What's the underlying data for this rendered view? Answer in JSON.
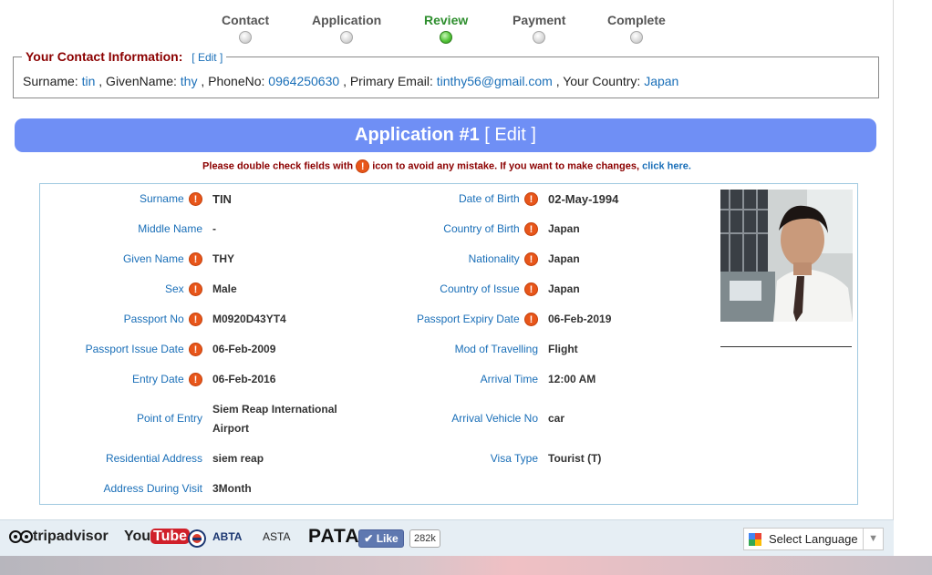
{
  "steps": [
    {
      "label": "Contact",
      "active": false
    },
    {
      "label": "Application",
      "active": false
    },
    {
      "label": "Review",
      "active": true
    },
    {
      "label": "Payment",
      "active": false
    },
    {
      "label": "Complete",
      "active": false
    }
  ],
  "contact": {
    "legend": "Your Contact Information:",
    "edit_label": "[ Edit ]",
    "surname_label": "Surname:",
    "surname": "tin",
    "given_label": ", GivenName:",
    "given": "thy",
    "phone_label": ", PhoneNo:",
    "phone": "0964250630",
    "email_label": ", Primary Email:",
    "email": "tinthy56@gmail.com",
    "country_label": ", Your Country:",
    "country": "Japan"
  },
  "application": {
    "title": "Application #1",
    "edit_label": "[ Edit ]",
    "warning_before": "Please double check fields with",
    "warning_after": "icon to avoid any mistake. If you want to make changes,",
    "warning_link": "click here.",
    "warn_icon_glyph": "!"
  },
  "fields_left": [
    {
      "label": "Surname",
      "value": "TIN",
      "warn": true
    },
    {
      "label": "Middle Name",
      "value": "-",
      "warn": false
    },
    {
      "label": "Given Name",
      "value": "THY",
      "warn": true
    },
    {
      "label": "Sex",
      "value": "Male",
      "warn": true
    },
    {
      "label": "Passport No",
      "value": "M0920D43YT4",
      "warn": true
    },
    {
      "label": "Passport Issue Date",
      "value": "06-Feb-2009",
      "warn": true
    },
    {
      "label": "Entry Date",
      "value": "06-Feb-2016",
      "warn": true
    },
    {
      "label": "Point of Entry",
      "value_line1": "Siem Reap International",
      "value_line2": "Airport",
      "warn": false
    },
    {
      "label": "Residential Address",
      "value": "siem reap",
      "warn": false
    },
    {
      "label": "Address During Visit",
      "value": "3Month",
      "warn": false
    }
  ],
  "fields_right": [
    {
      "label": "Date of Birth",
      "value": "02-May-1994",
      "warn": true
    },
    {
      "label": "Country of Birth",
      "value": "Japan",
      "warn": true
    },
    {
      "label": "Nationality",
      "value": "Japan",
      "warn": true
    },
    {
      "label": "Country of Issue",
      "value": "Japan",
      "warn": true
    },
    {
      "label": "Passport Expiry Date",
      "value": "06-Feb-2019",
      "warn": true
    },
    {
      "label": "Mod of Travelling",
      "value": "Flight",
      "warn": false
    },
    {
      "label": "Arrival Time",
      "value": "12:00 AM",
      "warn": false
    },
    {
      "label": "Arrival Vehicle No",
      "value": "car",
      "warn": false
    },
    {
      "label": "Visa Type",
      "value": "Tourist (T)",
      "warn": false
    }
  ],
  "footer": {
    "tripadvisor": "tripadvisor",
    "youtube_you": "You",
    "youtube_tube": "Tube",
    "abta": "ABTA",
    "asta": "ASTA",
    "pata": "PATA",
    "like_label": "Like",
    "like_count": "282k",
    "language_label": "Select Language",
    "language_arrow": "▼"
  },
  "colors": {
    "accent_blue": "#6f8ff5",
    "link_blue": "#1a6fb8",
    "warn_orange": "#e8561a",
    "active_green": "#2f8f2f",
    "legend_red": "#8b0000"
  }
}
